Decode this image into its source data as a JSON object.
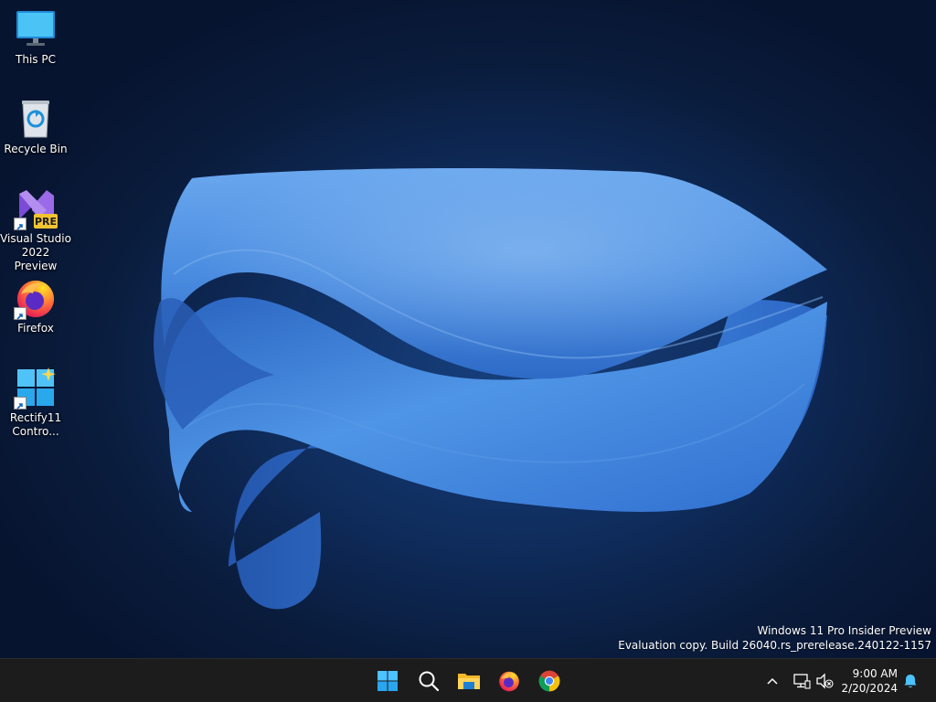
{
  "desktop": {
    "icons": [
      {
        "label": "This PC",
        "icon": "computer-icon"
      },
      {
        "label": "Recycle Bin",
        "icon": "recycle-bin-icon"
      },
      {
        "label": "Visual Studio\n2022 Preview",
        "icon": "visual-studio-icon",
        "badge": "PRE"
      },
      {
        "label": "Firefox",
        "icon": "firefox-icon"
      },
      {
        "label": "Rectify11\nContro...",
        "icon": "rectify11-icon"
      }
    ],
    "watermark": {
      "line1": "Windows 11 Pro Insider Preview",
      "line2": "Evaluation copy. Build 26040.rs_prerelease.240122-1157"
    }
  },
  "taskbar": {
    "apps": [
      {
        "name": "Start",
        "icon": "windows-start-icon"
      },
      {
        "name": "Search",
        "icon": "search-icon"
      },
      {
        "name": "File Explorer",
        "icon": "file-explorer-icon"
      },
      {
        "name": "Firefox",
        "icon": "firefox-icon"
      },
      {
        "name": "Google Chrome",
        "icon": "chrome-icon"
      }
    ],
    "tray": {
      "icons": [
        "chevron-up-icon",
        "network-icon",
        "volume-muted-icon",
        "notification-bell-icon"
      ],
      "time": "9:00 AM",
      "date": "2/20/2024"
    }
  },
  "colors": {
    "taskbar": "#1c1c1c",
    "wallpaper_dark": "#0a1c3c",
    "wallpaper_ribbon": "#3f86de",
    "accent": "#4cc2ff"
  }
}
